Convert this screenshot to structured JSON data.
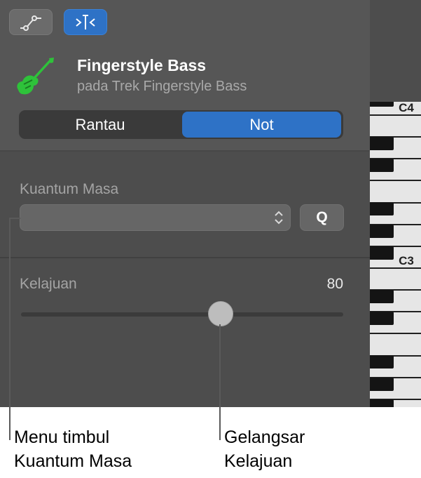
{
  "header": {
    "automation_icon": "automation-curve-icon",
    "quantize_tool_icon": "quantize-align-icon",
    "instrument_icon": "bass-guitar-icon",
    "track_name": "Fingerstyle Bass",
    "track_subtitle": "pada Trek Fingerstyle Bass"
  },
  "segmented": {
    "region_label": "Rantau",
    "notes_label": "Not",
    "selected": "Not"
  },
  "quantize": {
    "label": "Kuantum Masa",
    "value": "",
    "button_label": "Q"
  },
  "velocity": {
    "label": "Kelajuan",
    "value": "80",
    "level": 0.62
  },
  "keyboard": {
    "octave_labels": [
      "C4",
      "C3"
    ]
  },
  "callouts": {
    "popup_line1": "Menu timbul",
    "popup_line2": "Kuantum Masa",
    "slider_line1": "Gelangsar",
    "slider_line2": "Kelajuan"
  },
  "colors": {
    "accent": "#2e72c6",
    "instrument_icon": "#2ec23a",
    "panel": "#4d4d4d",
    "header": "#565656"
  }
}
